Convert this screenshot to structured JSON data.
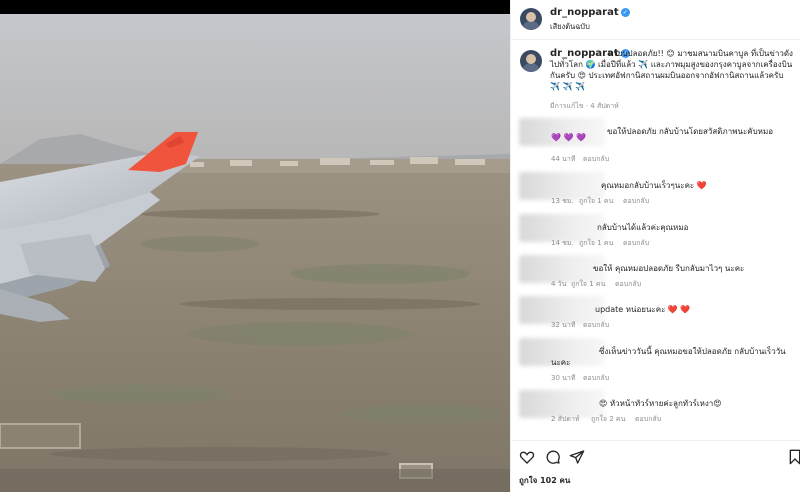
{
  "header": {
    "username": "dr_nopparat",
    "subtitle": "เสียงต้นฉบับ"
  },
  "post": {
    "username": "dr_nopparat",
    "caption_text": "หายบปลอดภัย!! 😊 มาชมสนามบินคาบูล ที่เป็นข่าวดังไปทั่วโลก 🌍 เมื่อปีที่แล้ว ✈️ และภาพมุมสูงของกรุงคาบูลจากเครื่องบินกันครับ 😍 ประเทศอัฟกานิสถานผมบินออกจากอัฟกานิสถานแล้วครับ ✈️ ✈️ ✈️",
    "meta": "มีการแก้ไข · 4 สัปดาห์"
  },
  "comments": [
    {
      "text": "ขอให้ปลอดภัย กลับบ้านโดยสวัสดิภาพนะคับหมอ",
      "prefix": "💜 💜 💜",
      "time": "44 นาที",
      "likes": "",
      "reply": "ตอบกลับ"
    },
    {
      "text": "คุณหมอกลับบ้านเร็วๆนะคะ ❤️",
      "time": "13 ชม.",
      "likes": "ถูกใจ 1 คน",
      "reply": "ตอบกลับ"
    },
    {
      "text": "กลับบ้านได้แล้วค่ะคุณหมอ",
      "time": "14 ชม.",
      "likes": "ถูกใจ 1 คน",
      "reply": "ตอบกลับ"
    },
    {
      "text": "ขอให้ คุณหมอปลอดภัย รีบกลับมาไวๆ นะคะ",
      "time": "4 วัน",
      "likes": "ถูกใจ 1 คน",
      "reply": "ตอบกลับ"
    },
    {
      "text": "update หน่อยนะคะ ❤️ ❤️",
      "time": "32 นาที",
      "likes": "",
      "reply": "ตอบกลับ"
    },
    {
      "text": "ซึ่งเห็นข่าววันนี้ คุณหมอขอให้ปลอดภัย กลับบ้านเร็ววันนะคะ",
      "time": "30 นาที",
      "likes": "",
      "reply": "ตอบกลับ"
    },
    {
      "text": "😍 หัวหน้าทัวร์หายค่ะลูกทัวร์เหงา😍",
      "time": "2 สัปดาห์",
      "likes": "ถูกใจ 2 คน",
      "reply": "ตอบกลับ"
    }
  ],
  "actions": {
    "likes_label": "ถูกใจ 102 คน"
  },
  "colors": {
    "verified": "#3897f0",
    "heart": "#e0245e",
    "tail": "#f0543c"
  },
  "icons": [
    "heart-icon",
    "comment-icon",
    "share-icon",
    "bookmark-icon",
    "verified-icon"
  ]
}
